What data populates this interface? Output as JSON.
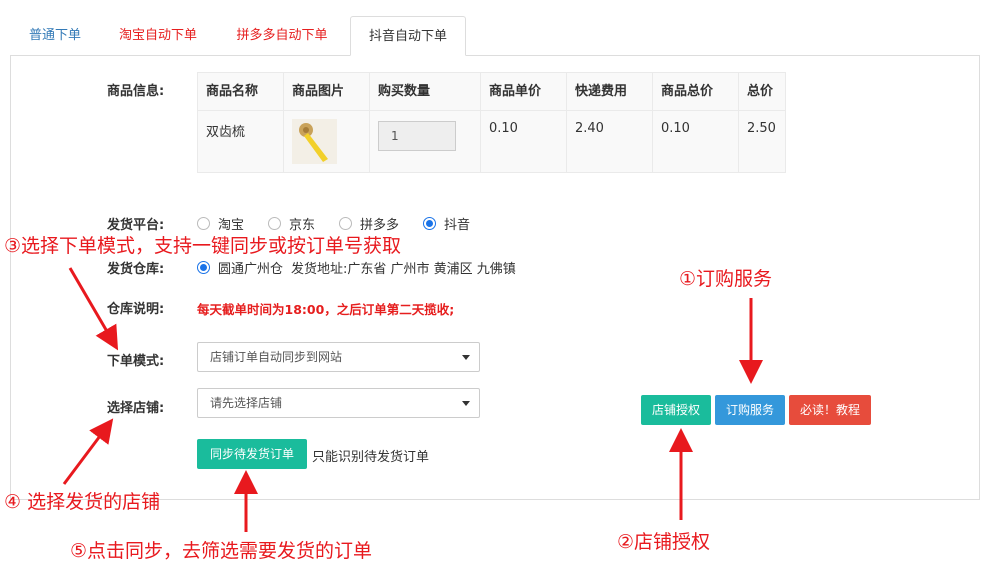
{
  "tabs": [
    {
      "label": "普通下单",
      "color": "#337ab7"
    },
    {
      "label": "淘宝自动下单",
      "color": "#e61e1e"
    },
    {
      "label": "拼多多自动下单",
      "color": "#e61e1e"
    },
    {
      "label": "抖音自动下单",
      "color": "#333333"
    }
  ],
  "product": {
    "label": "商品信息:",
    "headers": [
      "商品名称",
      "商品图片",
      "购买数量",
      "商品单价",
      "快递费用",
      "商品总价",
      "总价"
    ],
    "row": {
      "name": "双齿梳",
      "image": "comb-image",
      "quantity": "1",
      "unit_price": "0.10",
      "shipping": "2.40",
      "subtotal": "0.10",
      "total": "2.50"
    }
  },
  "platform": {
    "label": "发货平台:",
    "options": [
      "淘宝",
      "京东",
      "拼多多",
      "抖音"
    ],
    "selected": "抖音"
  },
  "warehouse": {
    "label": "发货仓库:",
    "option": "圆通广州仓",
    "address": "发货地址:广东省 广州市 黄浦区 九佛镇"
  },
  "warehouse_note": {
    "label": "仓库说明:",
    "text": "每天截单时间为18:00，之后订单第二天揽收;"
  },
  "order_mode": {
    "label": "下单模式:",
    "value": "店铺订单自动同步到网站"
  },
  "shop": {
    "label": "选择店铺:",
    "placeholder": "请先选择店铺"
  },
  "sync": {
    "button": "同步待发货订单",
    "hint": "只能识别待发货订单"
  },
  "actions": {
    "auth": "店铺授权",
    "subscribe": "订购服务",
    "tutorial": "必读！教程"
  },
  "annotations": {
    "a1": "①订购服务",
    "a2": "②店铺授权",
    "a3": "③选择下单模式，支持一键同步或按订单号获取",
    "a4": "④ 选择发货的店铺",
    "a5": "⑤点击同步，去筛选需要发货的订单"
  },
  "colors": {
    "accent_red": "#e8191e",
    "green": "#1abc9c",
    "blue": "#3498db",
    "danger": "#e74c3c"
  }
}
